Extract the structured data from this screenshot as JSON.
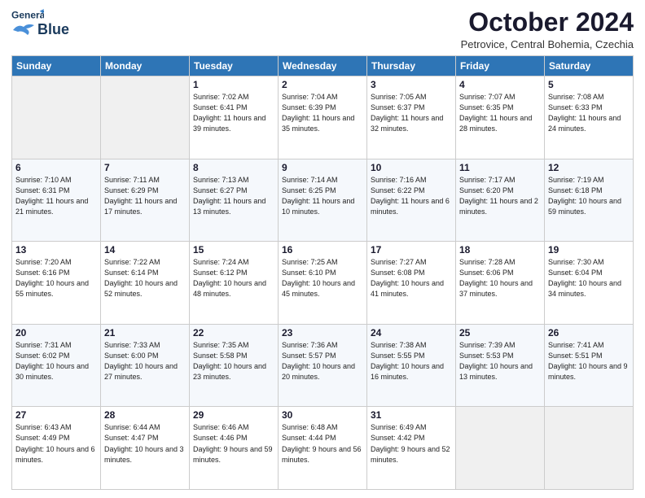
{
  "header": {
    "logo_line1": "General",
    "logo_line2": "Blue",
    "month": "October 2024",
    "location": "Petrovice, Central Bohemia, Czechia"
  },
  "days_of_week": [
    "Sunday",
    "Monday",
    "Tuesday",
    "Wednesday",
    "Thursday",
    "Friday",
    "Saturday"
  ],
  "weeks": [
    [
      {
        "day": "",
        "info": ""
      },
      {
        "day": "",
        "info": ""
      },
      {
        "day": "1",
        "info": "Sunrise: 7:02 AM\nSunset: 6:41 PM\nDaylight: 11 hours and 39 minutes."
      },
      {
        "day": "2",
        "info": "Sunrise: 7:04 AM\nSunset: 6:39 PM\nDaylight: 11 hours and 35 minutes."
      },
      {
        "day": "3",
        "info": "Sunrise: 7:05 AM\nSunset: 6:37 PM\nDaylight: 11 hours and 32 minutes."
      },
      {
        "day": "4",
        "info": "Sunrise: 7:07 AM\nSunset: 6:35 PM\nDaylight: 11 hours and 28 minutes."
      },
      {
        "day": "5",
        "info": "Sunrise: 7:08 AM\nSunset: 6:33 PM\nDaylight: 11 hours and 24 minutes."
      }
    ],
    [
      {
        "day": "6",
        "info": "Sunrise: 7:10 AM\nSunset: 6:31 PM\nDaylight: 11 hours and 21 minutes."
      },
      {
        "day": "7",
        "info": "Sunrise: 7:11 AM\nSunset: 6:29 PM\nDaylight: 11 hours and 17 minutes."
      },
      {
        "day": "8",
        "info": "Sunrise: 7:13 AM\nSunset: 6:27 PM\nDaylight: 11 hours and 13 minutes."
      },
      {
        "day": "9",
        "info": "Sunrise: 7:14 AM\nSunset: 6:25 PM\nDaylight: 11 hours and 10 minutes."
      },
      {
        "day": "10",
        "info": "Sunrise: 7:16 AM\nSunset: 6:22 PM\nDaylight: 11 hours and 6 minutes."
      },
      {
        "day": "11",
        "info": "Sunrise: 7:17 AM\nSunset: 6:20 PM\nDaylight: 11 hours and 2 minutes."
      },
      {
        "day": "12",
        "info": "Sunrise: 7:19 AM\nSunset: 6:18 PM\nDaylight: 10 hours and 59 minutes."
      }
    ],
    [
      {
        "day": "13",
        "info": "Sunrise: 7:20 AM\nSunset: 6:16 PM\nDaylight: 10 hours and 55 minutes."
      },
      {
        "day": "14",
        "info": "Sunrise: 7:22 AM\nSunset: 6:14 PM\nDaylight: 10 hours and 52 minutes."
      },
      {
        "day": "15",
        "info": "Sunrise: 7:24 AM\nSunset: 6:12 PM\nDaylight: 10 hours and 48 minutes."
      },
      {
        "day": "16",
        "info": "Sunrise: 7:25 AM\nSunset: 6:10 PM\nDaylight: 10 hours and 45 minutes."
      },
      {
        "day": "17",
        "info": "Sunrise: 7:27 AM\nSunset: 6:08 PM\nDaylight: 10 hours and 41 minutes."
      },
      {
        "day": "18",
        "info": "Sunrise: 7:28 AM\nSunset: 6:06 PM\nDaylight: 10 hours and 37 minutes."
      },
      {
        "day": "19",
        "info": "Sunrise: 7:30 AM\nSunset: 6:04 PM\nDaylight: 10 hours and 34 minutes."
      }
    ],
    [
      {
        "day": "20",
        "info": "Sunrise: 7:31 AM\nSunset: 6:02 PM\nDaylight: 10 hours and 30 minutes."
      },
      {
        "day": "21",
        "info": "Sunrise: 7:33 AM\nSunset: 6:00 PM\nDaylight: 10 hours and 27 minutes."
      },
      {
        "day": "22",
        "info": "Sunrise: 7:35 AM\nSunset: 5:58 PM\nDaylight: 10 hours and 23 minutes."
      },
      {
        "day": "23",
        "info": "Sunrise: 7:36 AM\nSunset: 5:57 PM\nDaylight: 10 hours and 20 minutes."
      },
      {
        "day": "24",
        "info": "Sunrise: 7:38 AM\nSunset: 5:55 PM\nDaylight: 10 hours and 16 minutes."
      },
      {
        "day": "25",
        "info": "Sunrise: 7:39 AM\nSunset: 5:53 PM\nDaylight: 10 hours and 13 minutes."
      },
      {
        "day": "26",
        "info": "Sunrise: 7:41 AM\nSunset: 5:51 PM\nDaylight: 10 hours and 9 minutes."
      }
    ],
    [
      {
        "day": "27",
        "info": "Sunrise: 6:43 AM\nSunset: 4:49 PM\nDaylight: 10 hours and 6 minutes."
      },
      {
        "day": "28",
        "info": "Sunrise: 6:44 AM\nSunset: 4:47 PM\nDaylight: 10 hours and 3 minutes."
      },
      {
        "day": "29",
        "info": "Sunrise: 6:46 AM\nSunset: 4:46 PM\nDaylight: 9 hours and 59 minutes."
      },
      {
        "day": "30",
        "info": "Sunrise: 6:48 AM\nSunset: 4:44 PM\nDaylight: 9 hours and 56 minutes."
      },
      {
        "day": "31",
        "info": "Sunrise: 6:49 AM\nSunset: 4:42 PM\nDaylight: 9 hours and 52 minutes."
      },
      {
        "day": "",
        "info": ""
      },
      {
        "day": "",
        "info": ""
      }
    ]
  ]
}
